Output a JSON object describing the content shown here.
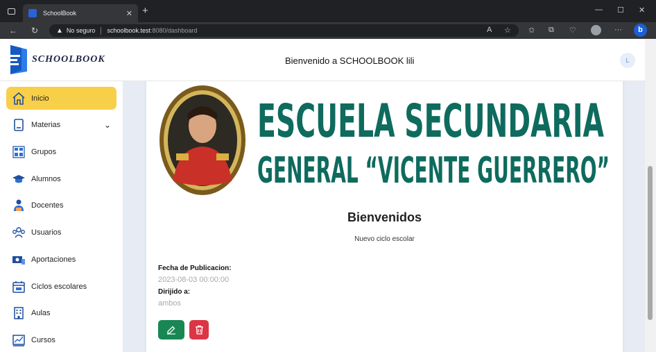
{
  "browser": {
    "tab_title": "SchoolBook",
    "security_label": "No seguro",
    "url_host": "schoolbook.test",
    "url_path": ":8080/dashboard"
  },
  "header": {
    "brand": "SCHOOLBOOK",
    "welcome": "Bienvenido a SCHOOLBOOK lili",
    "user_initial": "L"
  },
  "sidebar": {
    "items": [
      {
        "label": "Inicio",
        "icon": "home-icon",
        "active": true
      },
      {
        "label": "Materias",
        "icon": "book-icon",
        "expandable": true
      },
      {
        "label": "Grupos",
        "icon": "groups-icon"
      },
      {
        "label": "Alumnos",
        "icon": "graduation-cap-icon"
      },
      {
        "label": "Docentes",
        "icon": "teacher-icon"
      },
      {
        "label": "Usuarios",
        "icon": "users-icon"
      },
      {
        "label": "Aportaciones",
        "icon": "money-icon"
      },
      {
        "label": "Ciclos escolares",
        "icon": "calendar-icon"
      },
      {
        "label": "Aulas",
        "icon": "building-icon"
      },
      {
        "label": "Cursos",
        "icon": "chart-icon"
      }
    ]
  },
  "post": {
    "banner_line1": "ESCUELA SECUNDARIA",
    "banner_line2": "GENERAL “VICENTE GUERRERO”",
    "title": "Bienvenidos",
    "subtitle": "Nuevo ciclo escolar",
    "date_label": "Fecha de Publicacion:",
    "date_value": "2023-08-03 00:00:00",
    "audience_label": "Dirijido a:",
    "audience_value": "ambos"
  },
  "colors": {
    "accent": "#f8cf48",
    "banner_text": "#0e6b5e",
    "edit": "#198754",
    "delete": "#dc3545"
  }
}
